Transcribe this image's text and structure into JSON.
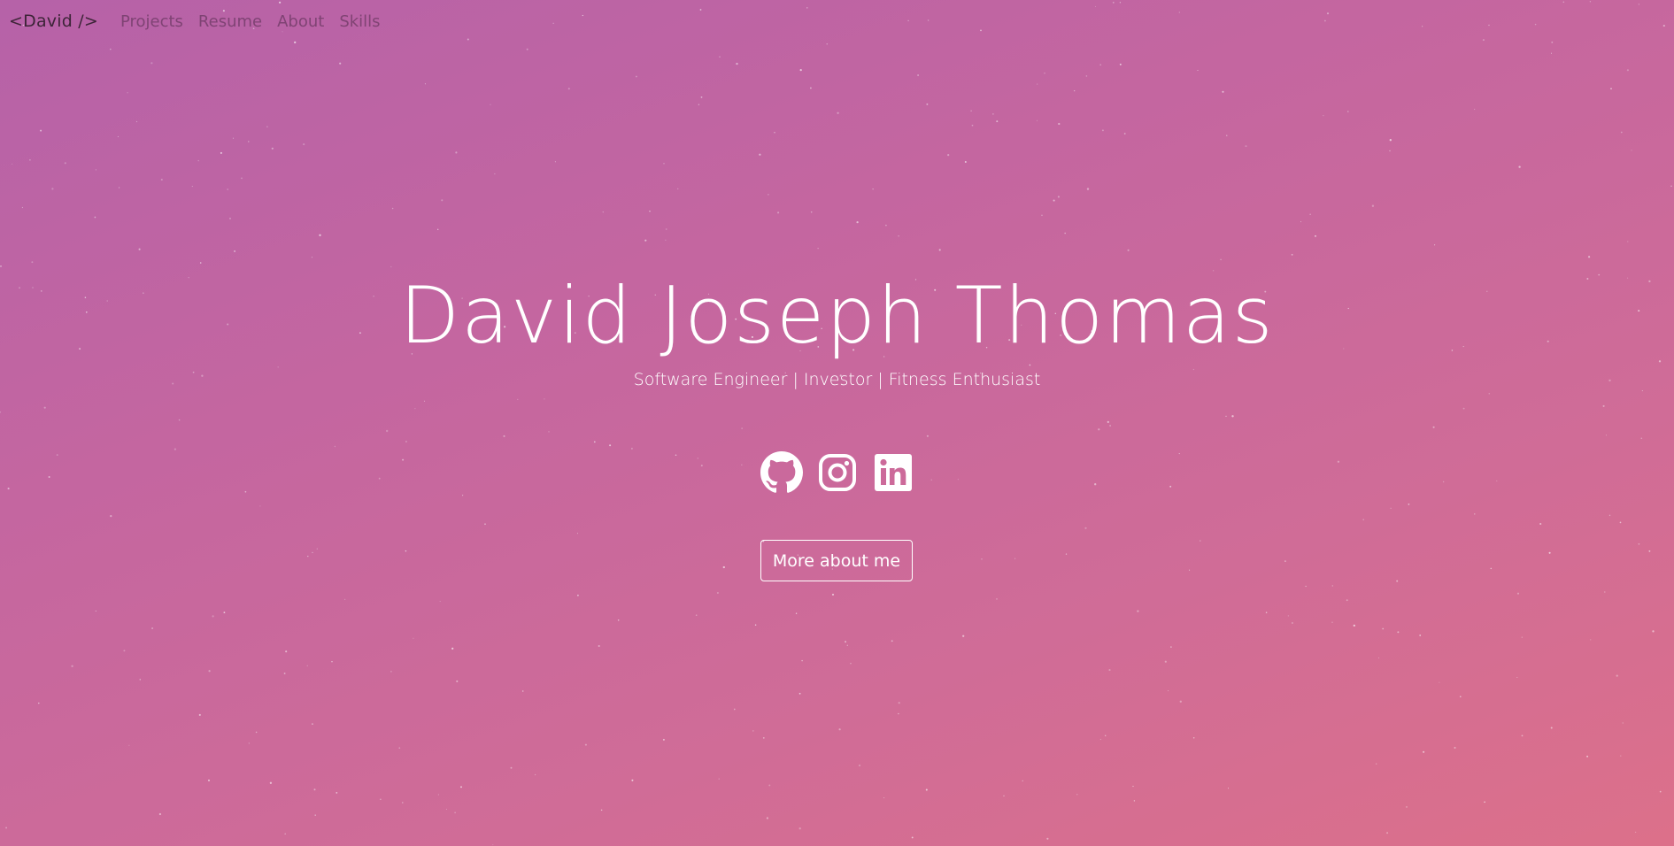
{
  "nav": {
    "brand": "<David />",
    "links": [
      "Projects",
      "Resume",
      "About",
      "Skills"
    ]
  },
  "hero": {
    "title": "David Joseph Thomas",
    "subtitle": "Software Engineer | Investor | Fitness Enthusiast",
    "cta_label": "More about me"
  },
  "social": [
    "github-icon",
    "instagram-icon",
    "linkedin-icon"
  ],
  "colors": {
    "gradient_start": "#b662a8",
    "gradient_end": "#dc708a",
    "text": "#ffffff",
    "brand_text": "#3d2438"
  }
}
